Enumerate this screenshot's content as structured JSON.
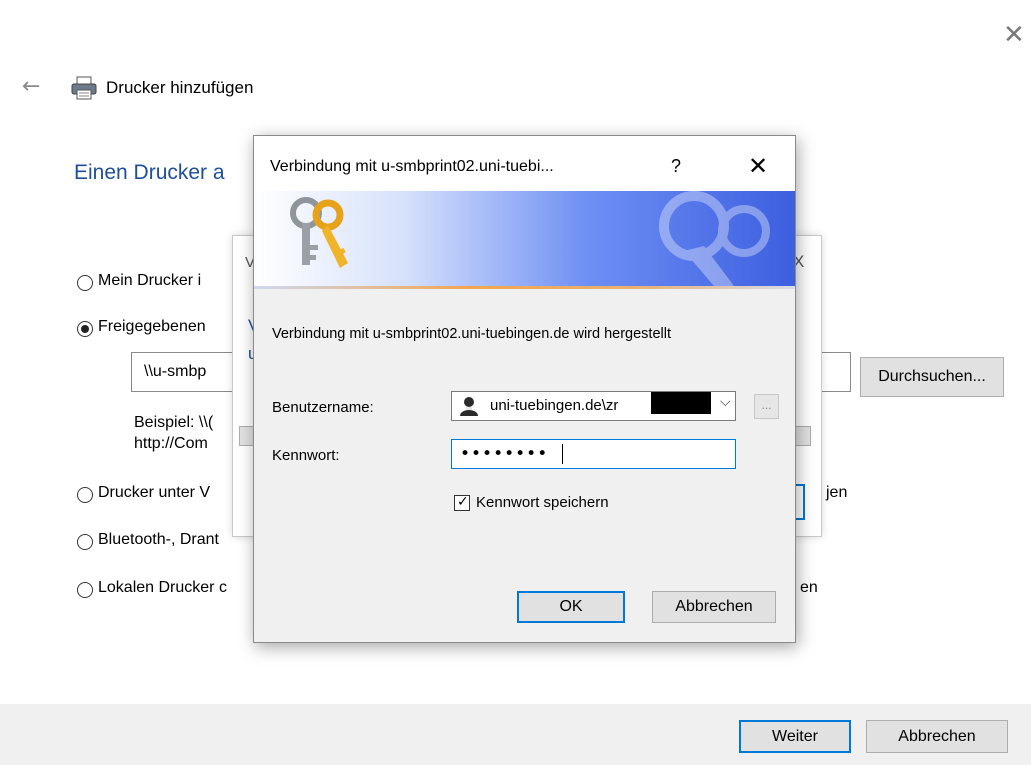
{
  "window": {
    "title": "Drucker hinzufügen",
    "close_icon": "close-icon",
    "back_icon": "back-arrow-icon"
  },
  "wizard": {
    "heading": "Einen Drucker a",
    "options": [
      {
        "label": "Mein Drucker i",
        "selected": false
      },
      {
        "label": "Freigegebenen",
        "selected": true
      },
      {
        "label": "Drucker unter V",
        "selected": false
      },
      {
        "label": "Bluetooth-, Drant",
        "selected": false
      },
      {
        "label": "Lokalen Drucker c",
        "selected": false
      }
    ],
    "path_value": "\\\\u-smbp",
    "browse_label": "Durchsuchen...",
    "hint_line1": "Beispiel: \\\\(",
    "hint_line2": "http://Com",
    "right_fragment_1": "jen",
    "right_fragment_2": "en"
  },
  "middle_dialog": {
    "frag_v": "V",
    "frag_v2": "V",
    "frag_u": "u",
    "frag_x": "X"
  },
  "credential_dialog": {
    "title": "Verbindung mit u-smbprint02.uni-tuebi...",
    "help_label": "?",
    "close_label": "✕",
    "message": "Verbindung mit u-smbprint02.uni-tuebingen.de wird hergestellt",
    "username_label": "Benutzername:",
    "username_value": "uni-tuebingen.de\\zr",
    "password_label": "Kennwort:",
    "password_value": "••••••••",
    "save_password_label": "Kennwort speichern",
    "save_password_checked": true,
    "ok_label": "OK",
    "cancel_label": "Abbrechen",
    "more_label": "..."
  },
  "footer": {
    "next_label": "Weiter",
    "cancel_label": "Abbrechen"
  }
}
